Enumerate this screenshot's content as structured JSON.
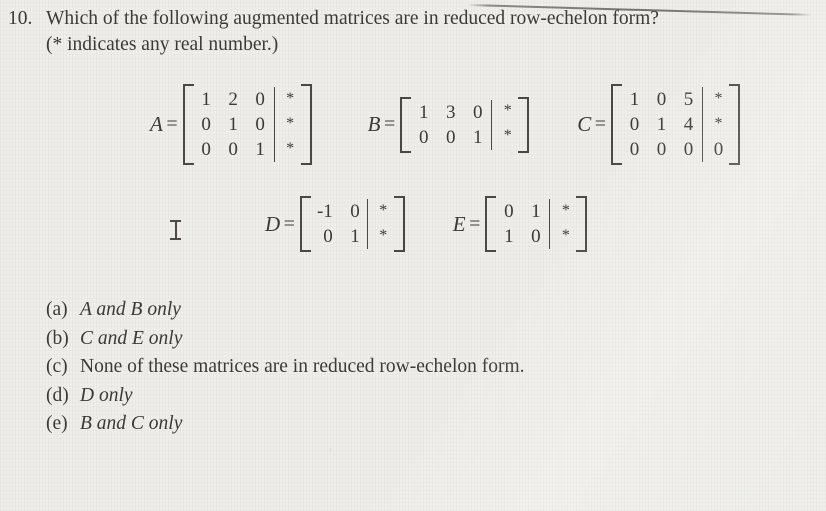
{
  "question": {
    "number": "10.",
    "line1": "Which of the following augmented matrices are in reduced row-echelon form?",
    "line2": "(* indicates any real number.)"
  },
  "matrices": [
    {
      "label": "A",
      "equals": "=",
      "coefficients": [
        [
          "1",
          "2",
          "0"
        ],
        [
          "0",
          "1",
          "0"
        ],
        [
          "0",
          "0",
          "1"
        ]
      ],
      "augment": [
        "*",
        "*",
        "*"
      ]
    },
    {
      "label": "B",
      "equals": "=",
      "coefficients": [
        [
          "1",
          "3",
          "0"
        ],
        [
          "0",
          "0",
          "1"
        ]
      ],
      "augment": [
        "*",
        "*"
      ]
    },
    {
      "label": "C",
      "equals": "=",
      "coefficients": [
        [
          "1",
          "0",
          "5"
        ],
        [
          "0",
          "1",
          "4"
        ],
        [
          "0",
          "0",
          "0"
        ]
      ],
      "augment": [
        "*",
        "*",
        "0"
      ]
    },
    {
      "label": "D",
      "equals": "=",
      "coefficients": [
        [
          "-1",
          "0"
        ],
        [
          "0",
          "1"
        ]
      ],
      "augment": [
        "*",
        "*"
      ]
    },
    {
      "label": "E",
      "equals": "=",
      "coefficients": [
        [
          "0",
          "1"
        ],
        [
          "1",
          "0"
        ]
      ],
      "augment": [
        "*",
        "*"
      ]
    }
  ],
  "choices": [
    {
      "tag": "(a)",
      "text": "A and B only"
    },
    {
      "tag": "(b)",
      "text": "C and E only"
    },
    {
      "tag": "(c)",
      "text": "None of these matrices are in reduced row-echelon form."
    },
    {
      "tag": "(d)",
      "text": "D only"
    },
    {
      "tag": "(e)",
      "text": "B and C only"
    }
  ],
  "artifacts": {
    "cursor": "text-ibeam-cursor",
    "rule": "horizontal-rule"
  },
  "colors": {
    "paper": "#efeeea",
    "ink": "#3c3a36",
    "rule": "#6e6c68"
  }
}
